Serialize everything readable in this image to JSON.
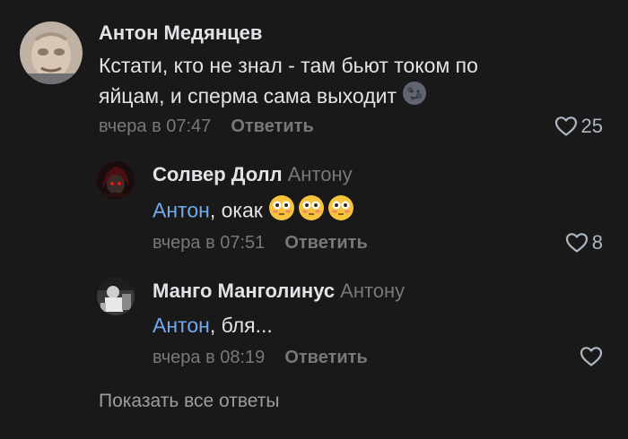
{
  "comments": [
    {
      "author": "Антон Медянцев",
      "text": "Кстати, кто не знал - там бьют током по яйцам, и сперма сама выходит",
      "emoji": "new-moon-face-emoji",
      "time": "вчера в 07:47",
      "reply_label": "Ответить",
      "likes": "25"
    },
    {
      "author": "Солвер Долл",
      "reply_to": "Антону",
      "mention": "Антон",
      "text": ", окак",
      "emoji": "flushed-face-emoji",
      "time": "вчера в 07:51",
      "reply_label": "Ответить",
      "likes": "8"
    },
    {
      "author": "Манго Манголинус",
      "reply_to": "Антону",
      "mention": "Антон",
      "text": ", бля...",
      "time": "вчера в 08:19",
      "reply_label": "Ответить",
      "likes": ""
    }
  ],
  "show_all_label": "Показать все ответы",
  "colors": {
    "background": "#19191a",
    "text": "#e1e3e6",
    "secondary": "#76787a",
    "mention": "#71aaeb",
    "like_icon": "#aeb7c2"
  }
}
